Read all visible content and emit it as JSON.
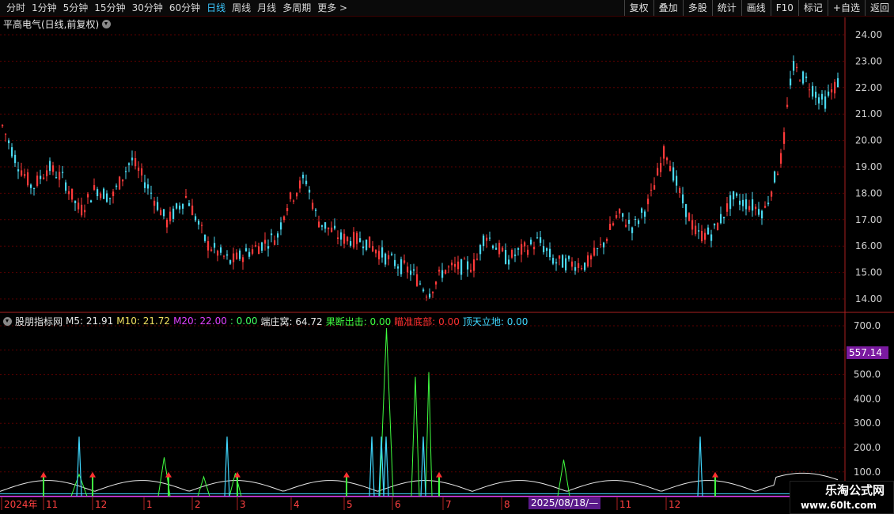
{
  "toolbar": {
    "periods": [
      "分时",
      "1分钟",
      "5分钟",
      "15分钟",
      "30分钟",
      "60分钟",
      "日线",
      "周线",
      "月线",
      "多周期",
      "更多 >"
    ],
    "active_period": "日线",
    "right_buttons": [
      "复权",
      "叠加",
      "多股",
      "统计",
      "画线",
      "F10",
      "标记",
      "+自选",
      "返回"
    ]
  },
  "main_title": "平高电气(日线,前复权)",
  "indicator": {
    "name": "股朋指标网",
    "m5": "M5: 21.91",
    "m10": "M10: 21.72",
    "m20": "M20: 22.00",
    "blank": ": 0.00",
    "duanzhuang": "端庄窝: 64.72",
    "guoduan": "果断出击: 0.00",
    "miaozhun": "瞄准底部: 0.00",
    "dingtian": "顶天立地: 0.00"
  },
  "price_tag": "557.14",
  "date_tag": "2025/08/18/—",
  "price_axis": [
    "24.00",
    "23.00",
    "22.00",
    "21.00",
    "20.00",
    "19.00",
    "18.00",
    "17.00",
    "16.00",
    "15.00",
    "14.00"
  ],
  "ind_axis": [
    "700.0",
    "600.0",
    "500.0",
    "400.0",
    "300.0",
    "200.0",
    "100.0"
  ],
  "x_labels": [
    "2024年",
    "11",
    "12",
    "1",
    "2",
    "3",
    "4",
    "5",
    "6",
    "7",
    "8",
    "10",
    "11",
    "12"
  ],
  "watermark": {
    "line1": "乐淘公式网",
    "line2": "www.60lt.com"
  },
  "colors": {
    "up": "#ff3a3a",
    "down": "#4ad8f0",
    "grid": "#5a0000",
    "axis": "#aa2020"
  }
}
